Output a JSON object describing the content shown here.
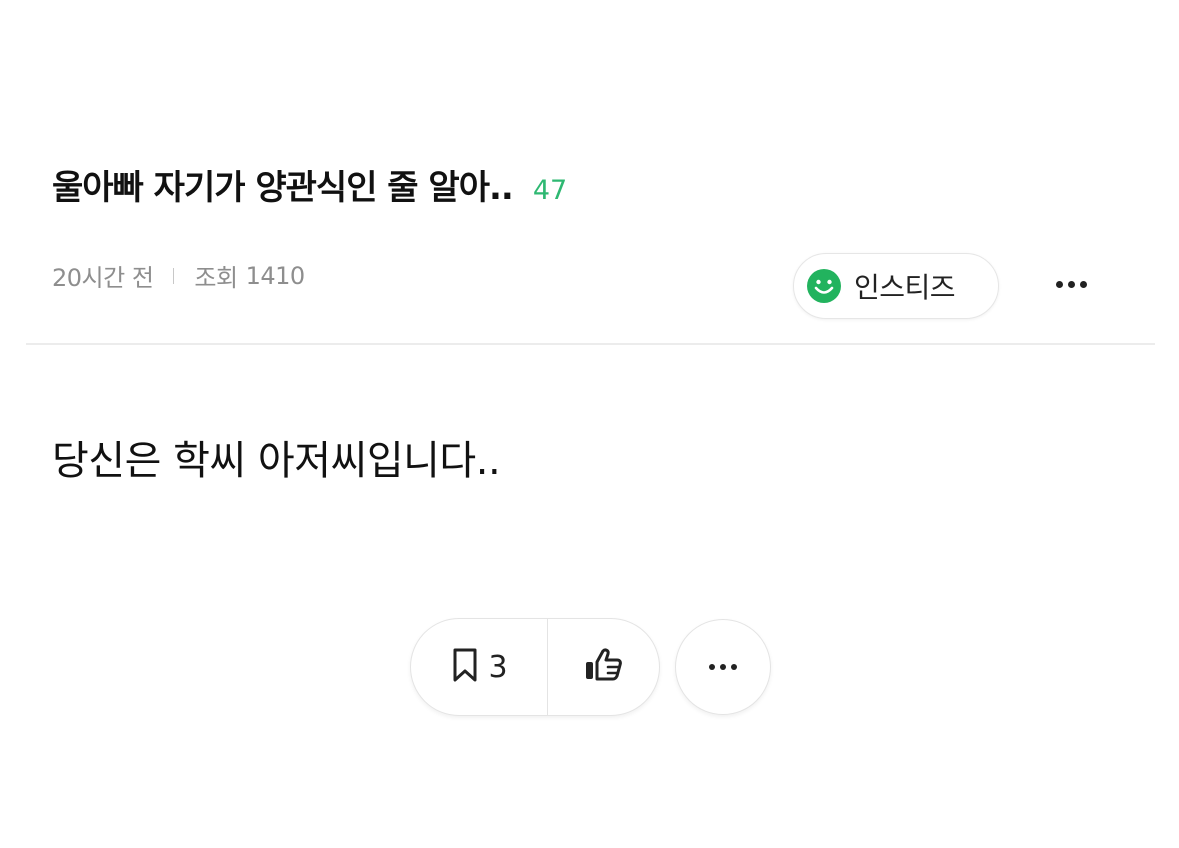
{
  "post": {
    "title": "울아빠 자기가 양관식인 줄 알아..",
    "comment_count": "47",
    "time_ago": "20시간 전",
    "views_label": "조회",
    "views_count": "1410",
    "body": "당신은 학씨 아저씨입니다.."
  },
  "community": {
    "name": "인스티즈",
    "icon": "smile-icon",
    "icon_color": "#22b35e"
  },
  "actions": {
    "scrap_icon": "bookmark-icon",
    "scrap_count": "3",
    "like_icon": "thumbs-up-icon",
    "more_icon": "more-dots-icon"
  },
  "colors": {
    "accent_green": "#2eb872",
    "meta_gray": "#8e8e8e",
    "text_dark": "#111111"
  }
}
